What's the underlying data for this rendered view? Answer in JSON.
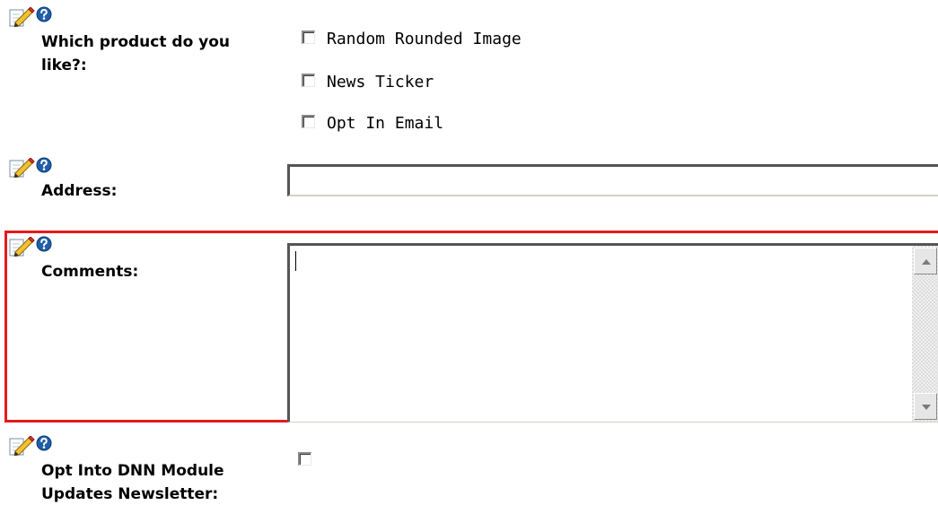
{
  "form": {
    "product": {
      "label": "Which product do you like?:",
      "options": [
        {
          "label": "Random Rounded Image",
          "checked": false
        },
        {
          "label": "News Ticker",
          "checked": false
        },
        {
          "label": "Opt In Email",
          "checked": false
        }
      ]
    },
    "address": {
      "label": "Address:",
      "value": ""
    },
    "comments": {
      "label": "Comments:",
      "value": ""
    },
    "newsletter": {
      "label": "Opt Into DNN Module Updates Newsletter:",
      "checked": false
    }
  },
  "icons": {
    "edit": "pencil-edit-icon",
    "help": "help-question-icon"
  },
  "colors": {
    "highlight": "#e41b1b",
    "help_icon": "#1f5fa8"
  }
}
